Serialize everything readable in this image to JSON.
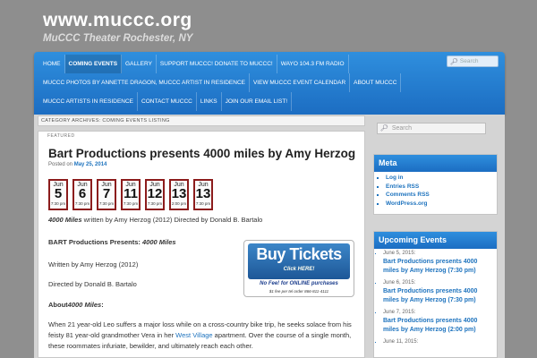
{
  "site": {
    "title": "www.muccc.org",
    "description": "MuCCC Theater Rochester, NY"
  },
  "nav": {
    "row1": [
      "HOME",
      "COMING EVENTS",
      "GALLERY",
      "SUPPORT MUCCC! DONATE TO MUCCC!",
      "WAYO 104.3 FM RADIO"
    ],
    "row2": [
      "MUCCC PHOTOS BY ANNETTE DRAGON, MUCCC ARTIST IN RESIDENCE",
      "VIEW MUCCC EVENT CALENDAR",
      "ABOUT MUCCC"
    ],
    "row3": [
      "MUCCC ARTISTS IN RESIDENCE",
      "CONTACT MUCCC",
      "LINKS",
      "JOIN OUR EMAIL LIST!"
    ],
    "active": "COMING EVENTS",
    "search_placeholder": "Search",
    "search_icon": "magnifier-icon"
  },
  "archive": {
    "label": "CATEGORY ARCHIVES: COMING EVENTS LISTING"
  },
  "post": {
    "tag": "FEATURED",
    "title": "Bart Productions presents 4000 miles by Amy Herzog",
    "posted_prefix": "Posted on",
    "posted_date": "May 25, 2014",
    "dates": [
      {
        "month": "Jun",
        "day": "5",
        "time": "7:30 pm"
      },
      {
        "month": "Jun",
        "day": "6",
        "time": "7:30 pm"
      },
      {
        "month": "Jun",
        "day": "7",
        "time": "7:30 pm"
      },
      {
        "month": "Jun",
        "day": "11",
        "time": "7:30 pm"
      },
      {
        "month": "Jun",
        "day": "12",
        "time": "7:30 pm"
      },
      {
        "month": "Jun",
        "day": "13",
        "time": "2:00 pm"
      },
      {
        "month": "Jun",
        "day": "13",
        "time": "7:30 pm"
      }
    ],
    "credits_title": "4000 Miles",
    "credits_rest": " written by Amy Herzog (2012) Directed by Donald B. Bartalo",
    "presents_label": "BART Productions Presents: ",
    "presents_title": "4000 Miles",
    "written": "Written by Amy Herzog (2012)",
    "directed": "Directed by Donald B. Bartalo",
    "about_prefix": "About",
    "about_title": "4000 Miles",
    "about_suffix": ":",
    "synopsis_before": "When 21 year-old Leo suffers a major loss while on a cross-country bike trip, he seeks solace from his feisty 81 year-old grandmother Vera in her ",
    "synopsis_link": "West Village",
    "synopsis_after": " apartment. Over the course of a single month, these roommates infuriate, bewilder, and ultimately reach each other.",
    "buy": {
      "main": "Buy Tickets",
      "sub": "Click HERE!",
      "note1": "No Fee! for ONLINE purchases",
      "note2": "$1 fee per tel order 866-811-4111"
    }
  },
  "sidebar": {
    "search_placeholder": "Search",
    "meta_title": "Meta",
    "meta_items": [
      "Log in",
      "Entries RSS",
      "Comments RSS",
      "WordPress.org"
    ],
    "upcoming_title": "Upcoming Events",
    "events": [
      {
        "date": "June 5, 2015:",
        "title": "Bart Productions presents 4000 miles by Amy Herzog (7:30 pm)"
      },
      {
        "date": "June 6, 2015:",
        "title": "Bart Productions presents 4000 miles by Amy Herzog (7:30 pm)"
      },
      {
        "date": "June 7, 2015:",
        "title": "Bart Productions presents 4000 miles by Amy Herzog (2:00 pm)"
      },
      {
        "date": "June 11, 2015:",
        "title": ""
      }
    ]
  },
  "colors": {
    "accent": "#1e73be",
    "nav_blue": "#2f8fde",
    "date_border": "#8c1c1c",
    "header_gray": "#8e8e8e"
  }
}
